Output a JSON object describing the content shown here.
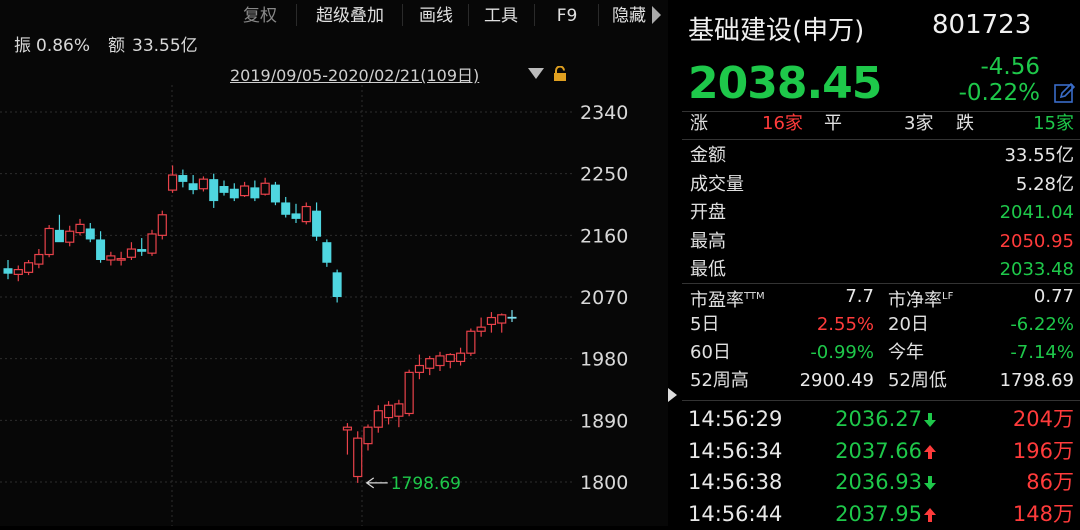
{
  "toolbar": {
    "items": [
      "复权",
      "超级叠加",
      "画线",
      "工具",
      "F9",
      "隐藏"
    ]
  },
  "info": {
    "amplitude_label": "振",
    "amplitude_value": "0.86%",
    "turnover_label": "额",
    "turnover_value": "33.55亿"
  },
  "range": {
    "label": "2019/09/05-2020/02/21(109日)"
  },
  "chart_data": {
    "type": "candlestick",
    "y_ticks": [
      "2340",
      "2250",
      "2160",
      "2070",
      "1980",
      "1890",
      "1800"
    ],
    "ylim": [
      1782.37,
      2392.86
    ],
    "low_annotation": {
      "label": "1798.69",
      "value": 1798.69
    },
    "candles": [
      {
        "o": 2112,
        "h": 2124,
        "l": 2096,
        "c": 2104
      },
      {
        "o": 2103,
        "h": 2116,
        "l": 2093,
        "c": 2110
      },
      {
        "o": 2106,
        "h": 2124,
        "l": 2102,
        "c": 2120
      },
      {
        "o": 2118,
        "h": 2140,
        "l": 2112,
        "c": 2132
      },
      {
        "o": 2132,
        "h": 2175,
        "l": 2128,
        "c": 2170
      },
      {
        "o": 2168,
        "h": 2190,
        "l": 2160,
        "c": 2150
      },
      {
        "o": 2150,
        "h": 2174,
        "l": 2144,
        "c": 2166
      },
      {
        "o": 2164,
        "h": 2184,
        "l": 2160,
        "c": 2176
      },
      {
        "o": 2170,
        "h": 2178,
        "l": 2150,
        "c": 2154
      },
      {
        "o": 2154,
        "h": 2166,
        "l": 2120,
        "c": 2124
      },
      {
        "o": 2124,
        "h": 2136,
        "l": 2116,
        "c": 2130
      },
      {
        "o": 2126,
        "h": 2136,
        "l": 2116,
        "c": 2126
      },
      {
        "o": 2128,
        "h": 2150,
        "l": 2124,
        "c": 2140
      },
      {
        "o": 2140,
        "h": 2156,
        "l": 2130,
        "c": 2136
      },
      {
        "o": 2134,
        "h": 2168,
        "l": 2130,
        "c": 2162
      },
      {
        "o": 2160,
        "h": 2196,
        "l": 2154,
        "c": 2190
      },
      {
        "o": 2226,
        "h": 2262,
        "l": 2222,
        "c": 2248
      },
      {
        "o": 2248,
        "h": 2256,
        "l": 2230,
        "c": 2238
      },
      {
        "o": 2236,
        "h": 2248,
        "l": 2220,
        "c": 2226
      },
      {
        "o": 2228,
        "h": 2246,
        "l": 2224,
        "c": 2242
      },
      {
        "o": 2242,
        "h": 2250,
        "l": 2200,
        "c": 2210
      },
      {
        "o": 2232,
        "h": 2240,
        "l": 2218,
        "c": 2222
      },
      {
        "o": 2228,
        "h": 2236,
        "l": 2210,
        "c": 2214
      },
      {
        "o": 2218,
        "h": 2238,
        "l": 2216,
        "c": 2232
      },
      {
        "o": 2230,
        "h": 2240,
        "l": 2210,
        "c": 2214
      },
      {
        "o": 2220,
        "h": 2244,
        "l": 2218,
        "c": 2236
      },
      {
        "o": 2234,
        "h": 2238,
        "l": 2204,
        "c": 2208
      },
      {
        "o": 2208,
        "h": 2216,
        "l": 2186,
        "c": 2190
      },
      {
        "o": 2192,
        "h": 2206,
        "l": 2178,
        "c": 2184
      },
      {
        "o": 2180,
        "h": 2208,
        "l": 2176,
        "c": 2202
      },
      {
        "o": 2196,
        "h": 2208,
        "l": 2152,
        "c": 2158
      },
      {
        "o": 2150,
        "h": 2154,
        "l": 2114,
        "c": 2120
      },
      {
        "o": 2106,
        "h": 2110,
        "l": 2062,
        "c": 2070
      },
      {
        "o": 1876,
        "h": 1886,
        "l": 1840,
        "c": 1880
      },
      {
        "o": 1808,
        "h": 1874,
        "l": 1798.69,
        "c": 1864
      },
      {
        "o": 1856,
        "h": 1884,
        "l": 1846,
        "c": 1880
      },
      {
        "o": 1880,
        "h": 1912,
        "l": 1872,
        "c": 1904
      },
      {
        "o": 1894,
        "h": 1918,
        "l": 1884,
        "c": 1912
      },
      {
        "o": 1896,
        "h": 1920,
        "l": 1880,
        "c": 1914
      },
      {
        "o": 1900,
        "h": 1964,
        "l": 1896,
        "c": 1960
      },
      {
        "o": 1960,
        "h": 1986,
        "l": 1950,
        "c": 1970
      },
      {
        "o": 1966,
        "h": 1984,
        "l": 1956,
        "c": 1980
      },
      {
        "o": 1970,
        "h": 1990,
        "l": 1962,
        "c": 1984
      },
      {
        "o": 1976,
        "h": 1988,
        "l": 1966,
        "c": 1986
      },
      {
        "o": 1976,
        "h": 1996,
        "l": 1970,
        "c": 1988
      },
      {
        "o": 1988,
        "h": 2024,
        "l": 1984,
        "c": 2020
      },
      {
        "o": 2020,
        "h": 2040,
        "l": 2012,
        "c": 2026
      },
      {
        "o": 2030,
        "h": 2048,
        "l": 2018,
        "c": 2040
      },
      {
        "o": 2032,
        "h": 2046,
        "l": 2018,
        "c": 2044
      },
      {
        "o": 2041.04,
        "h": 2050.95,
        "l": 2033.48,
        "c": 2038.45
      }
    ]
  },
  "quote": {
    "name": "基础建设(申万)",
    "code": "801723",
    "price": "2038.45",
    "change": "-4.56",
    "change_pct": "-0.22%",
    "breadth": {
      "up_label": "涨",
      "up_value": "16家",
      "flat_label": "平",
      "flat_value": "3家",
      "down_label": "跌",
      "down_value": "15家"
    },
    "stats": [
      {
        "label": "金额",
        "value": "33.55亿",
        "color": "white"
      },
      {
        "label": "成交量",
        "value": "5.28亿",
        "color": "white"
      },
      {
        "label": "开盘",
        "value": "2041.04",
        "color": "green"
      },
      {
        "label": "最高",
        "value": "2050.95",
        "color": "red"
      },
      {
        "label": "最低",
        "value": "2033.48",
        "color": "green"
      }
    ],
    "ratios": {
      "pe_label": "市盈率",
      "pe_sup": "TTM",
      "pe_value": "7.7",
      "pb_label": "市净率",
      "pb_sup": "LF",
      "pb_value": "0.77",
      "d5_label": "5日",
      "d5_value": "2.55%",
      "d20_label": "20日",
      "d20_value": "-6.22%",
      "d60_label": "60日",
      "d60_value": "-0.99%",
      "ytd_label": "今年",
      "ytd_value": "-7.14%",
      "w52h_label": "52周高",
      "w52h_value": "2900.49",
      "w52l_label": "52周低",
      "w52l_value": "1798.69"
    },
    "ticks": [
      {
        "time": "14:56:29",
        "price": "2036.27",
        "dir": "down",
        "vol": "204万"
      },
      {
        "time": "14:56:34",
        "price": "2037.66",
        "dir": "up",
        "vol": "196万"
      },
      {
        "time": "14:56:38",
        "price": "2036.93",
        "dir": "down",
        "vol": "86万"
      },
      {
        "time": "14:56:44",
        "price": "2037.95",
        "dir": "up",
        "vol": "148万"
      }
    ]
  }
}
